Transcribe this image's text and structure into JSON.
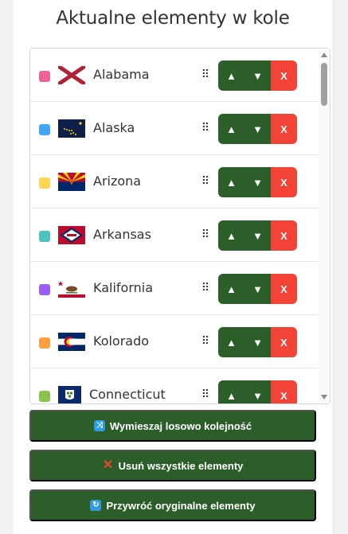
{
  "title": "Aktualne elementy w kole",
  "items": [
    {
      "name": "Alabama",
      "color": "#f06292",
      "flag": "alabama-flag-icon"
    },
    {
      "name": "Alaska",
      "color": "#42a5f5",
      "flag": "alaska-flag-icon"
    },
    {
      "name": "Arizona",
      "color": "#ffd54f",
      "flag": "arizona-flag-icon"
    },
    {
      "name": "Arkansas",
      "color": "#4dc0c0",
      "flag": "arkansas-flag-icon"
    },
    {
      "name": "Kalifornia",
      "color": "#9c5cf5",
      "flag": "california-flag-icon"
    },
    {
      "name": "Kolorado",
      "color": "#ff9f40",
      "flag": "colorado-flag-icon"
    },
    {
      "name": "Connecticut",
      "color": "#8bc34a",
      "flag": "connecticut-flag-icon"
    }
  ],
  "row_buttons": {
    "up": "▲",
    "down": "▼",
    "delete": "X"
  },
  "drag_handle": "⠿",
  "actions": {
    "shuffle": "Wymieszaj losowo kolejność",
    "remove_all": "Usuń wszystkie elementy",
    "restore": "Przywróć oryginalne elementy"
  }
}
